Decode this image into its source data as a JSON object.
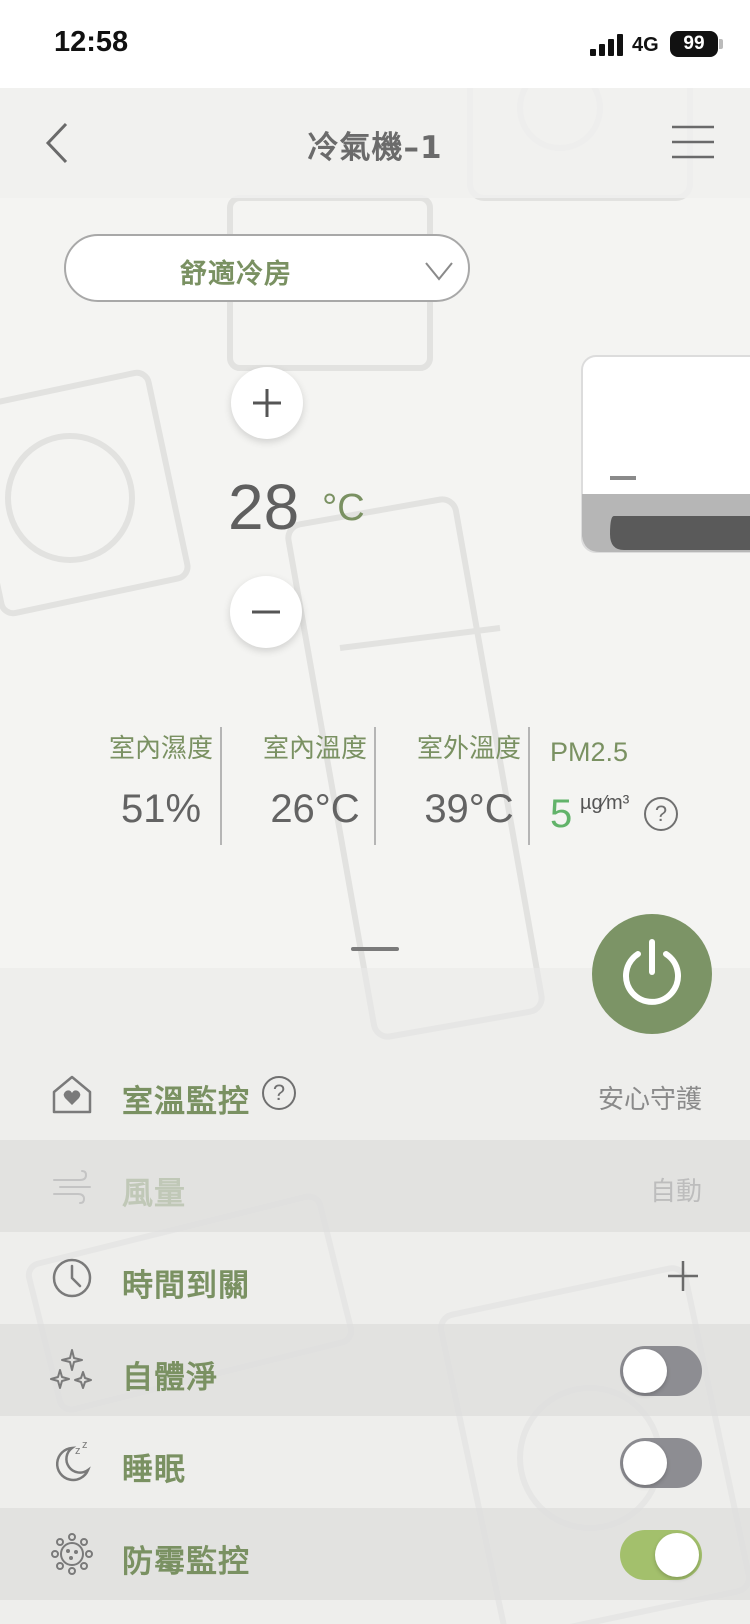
{
  "status_bar": {
    "time": "12:58",
    "network": "4G",
    "battery": "99"
  },
  "header": {
    "title": "冷氣機–1"
  },
  "mode": {
    "selected": "舒適冷房"
  },
  "temperature": {
    "value": "28",
    "unit": "°C"
  },
  "stats": [
    {
      "label": "室內濕度",
      "value": "51%"
    },
    {
      "label": "室內溫度",
      "value": "26°C"
    },
    {
      "label": "室外溫度",
      "value": "39°C"
    }
  ],
  "pm25": {
    "label": "PM2.5",
    "value": "5",
    "unit": "µg⁄m³",
    "help": "?"
  },
  "controls": {
    "temp_monitor": {
      "label": "室溫監控",
      "value": "安心守護",
      "help": "?"
    },
    "fan_speed": {
      "label": "風量",
      "value": "自動"
    },
    "timer_off": {
      "label": "時間到關"
    },
    "self_clean": {
      "label": "自體淨",
      "on": false
    },
    "sleep": {
      "label": "睡眠",
      "on": false
    },
    "mold_monitor": {
      "label": "防霉監控",
      "on": true
    }
  },
  "colors": {
    "accent": "#7a9162",
    "power": "#7c9466",
    "toggle_on": "#a3c06c",
    "pm_good": "#62b36a"
  }
}
